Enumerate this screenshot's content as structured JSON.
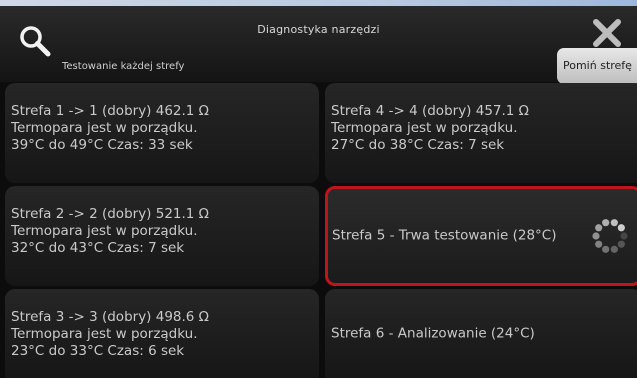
{
  "header": {
    "title": "Diagnostyka narzędzi",
    "subtitle": "Testowanie każdej strefy",
    "skip_button": "Pomiń strefę",
    "search_icon": "search-icon",
    "close_icon": "close-icon"
  },
  "zones": [
    {
      "line1": "Strefa 1 -> 1 (dobry) 462.1 Ω",
      "line2": "Termopara jest w porządku.",
      "line3": "39°C do 49°C Czas: 33 sek"
    },
    {
      "line1": "Strefa 4 -> 4 (dobry) 457.1 Ω",
      "line2": "Termopara jest w porządku.",
      "line3": "27°C do 38°C Czas: 7 sek"
    },
    {
      "line1": "Strefa 2 -> 2 (dobry) 521.1 Ω",
      "line2": "Termopara jest w porządku.",
      "line3": "32°C do 43°C Czas: 7 sek"
    },
    {
      "line1": "Strefa 5 - Trwa testowanie (28°C)",
      "status": "testing"
    },
    {
      "line1": "Strefa 3 -> 3 (dobry) 498.6 Ω",
      "line2": "Termopara jest w porządku.",
      "line3": "23°C do 33°C Czas: 6 sek"
    },
    {
      "line1": "Strefa 6 - Analizowanie (24°C)"
    }
  ],
  "colors": {
    "active_border": "#c0141c",
    "tile_text": "#c9c9c9"
  }
}
